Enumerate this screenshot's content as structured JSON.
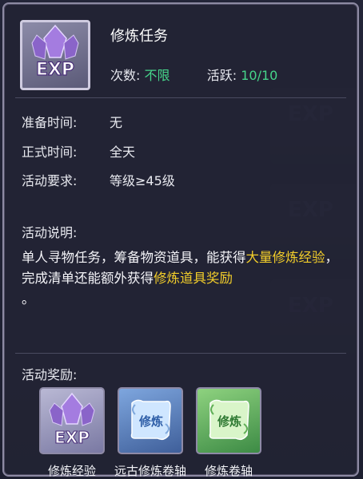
{
  "item": {
    "name": "修炼任务",
    "icon_text": "EXP",
    "times_label": "次数:",
    "times_value": "不限",
    "activity_label": "活跃:",
    "activity_value": "10/10"
  },
  "details": {
    "prep_label": "准备时间:",
    "prep_value": "无",
    "official_label": "正式时间:",
    "official_value": "全天",
    "req_label": "活动要求:",
    "req_value": "等级≥45级"
  },
  "description": {
    "heading": "活动说明:",
    "part1": "单人寻物任务，筹备物资道具，能获得",
    "highlight1": "大量修炼经验",
    "part2": "，完成清单还能额外获得",
    "highlight2": "修炼道具奖励",
    "part3": "。"
  },
  "rewards": {
    "heading": "活动奖励:",
    "items": [
      {
        "label": "修炼经验",
        "icon_text": "EXP"
      },
      {
        "label": "远古修炼卷轴",
        "icon_text": "修炼"
      },
      {
        "label": "修炼卷轴",
        "icon_text": "修炼"
      }
    ]
  },
  "colors": {
    "highlight": "#f2cd2a",
    "value_green": "#46d58a",
    "panel_border": "#8d8aa3"
  }
}
